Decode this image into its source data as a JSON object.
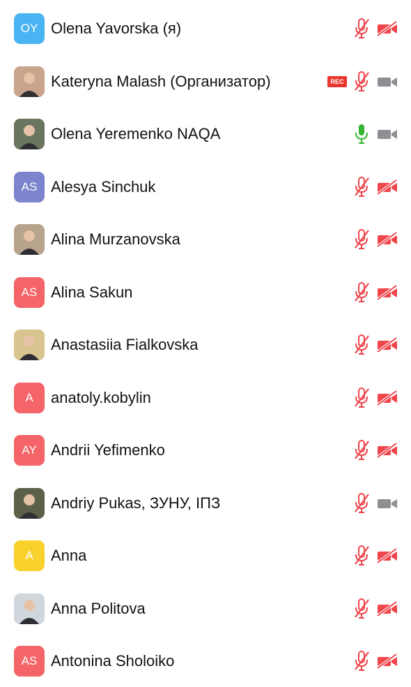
{
  "participants": [
    {
      "name": "Olena Yavorska (я)",
      "initials": "OY",
      "avatar_color": "#4ab4f2",
      "photo": false,
      "rec": false,
      "mic": "muted",
      "cam": "off"
    },
    {
      "name": "Kateryna Malash (Организатор)",
      "initials": "",
      "avatar_color": "#c9a58d",
      "photo": true,
      "rec": true,
      "mic": "muted",
      "cam": "on"
    },
    {
      "name": "Olena Yeremenko NAQA",
      "initials": "",
      "avatar_color": "#6a7560",
      "photo": true,
      "rec": false,
      "mic": "on",
      "cam": "on"
    },
    {
      "name": "Alesya  Sinchuk",
      "initials": "AS",
      "avatar_color": "#7b84cc",
      "photo": false,
      "rec": false,
      "mic": "muted",
      "cam": "off"
    },
    {
      "name": "Alina Murzanovska",
      "initials": "",
      "avatar_color": "#b8a48c",
      "photo": true,
      "rec": false,
      "mic": "muted",
      "cam": "off"
    },
    {
      "name": "Alina Sakun",
      "initials": "AS",
      "avatar_color": "#f56468",
      "photo": false,
      "rec": false,
      "mic": "muted",
      "cam": "off"
    },
    {
      "name": "Anastasiia Fialkovska",
      "initials": "",
      "avatar_color": "#d8c48e",
      "photo": true,
      "rec": false,
      "mic": "muted",
      "cam": "off"
    },
    {
      "name": "anatoly.kobylin",
      "initials": "A",
      "avatar_color": "#f56468",
      "photo": false,
      "rec": false,
      "mic": "muted",
      "cam": "off"
    },
    {
      "name": "Andrii Yefimenko",
      "initials": "AY",
      "avatar_color": "#f56468",
      "photo": false,
      "rec": false,
      "mic": "muted",
      "cam": "off"
    },
    {
      "name": "Andriy Pukas, ЗУНУ, ІПЗ",
      "initials": "",
      "avatar_color": "#5a6148",
      "photo": true,
      "rec": false,
      "mic": "muted",
      "cam": "on"
    },
    {
      "name": "Anna",
      "initials": "A",
      "avatar_color": "#f8d12c",
      "photo": false,
      "rec": false,
      "mic": "muted",
      "cam": "off"
    },
    {
      "name": "Anna Politova",
      "initials": "",
      "avatar_color": "#cfd6dc",
      "photo": true,
      "rec": false,
      "mic": "muted",
      "cam": "off"
    },
    {
      "name": "Antonina Sholoiko",
      "initials": "AS",
      "avatar_color": "#f56468",
      "photo": false,
      "rec": false,
      "mic": "muted",
      "cam": "off"
    }
  ],
  "rec_label": "REC",
  "colors": {
    "muted": "#f0454b",
    "mic_on": "#35b52f",
    "cam_on": "#8e8e93"
  }
}
